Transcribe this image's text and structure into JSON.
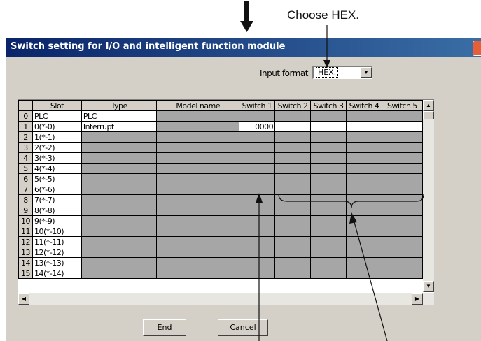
{
  "annotation": {
    "choose_text": "Choose HEX."
  },
  "dialog": {
    "title": "Switch setting for I/O and intelligent function module",
    "input_format_label": "Input format",
    "input_format_value": "HEX.",
    "buttons": {
      "end": "End",
      "cancel": "Cancel"
    }
  },
  "table": {
    "columns": [
      "",
      "Slot",
      "Type",
      "Model name",
      "Switch 1",
      "Switch 2",
      "Switch 3",
      "Switch 4",
      "Switch 5"
    ],
    "rows": [
      {
        "no": "0",
        "slot": "PLC",
        "type": "PLC",
        "model": "",
        "sw1": ""
      },
      {
        "no": "1",
        "slot": "0(*-0)",
        "type": "Interrupt",
        "model": "",
        "sw1": "0000"
      },
      {
        "no": "2",
        "slot": "1(*-1)",
        "type": "",
        "model": "",
        "sw1": ""
      },
      {
        "no": "3",
        "slot": "2(*-2)",
        "type": "",
        "model": "",
        "sw1": ""
      },
      {
        "no": "4",
        "slot": "3(*-3)",
        "type": "",
        "model": "",
        "sw1": ""
      },
      {
        "no": "5",
        "slot": "4(*-4)",
        "type": "",
        "model": "",
        "sw1": ""
      },
      {
        "no": "6",
        "slot": "5(*-5)",
        "type": "",
        "model": "",
        "sw1": ""
      },
      {
        "no": "7",
        "slot": "6(*-6)",
        "type": "",
        "model": "",
        "sw1": ""
      },
      {
        "no": "8",
        "slot": "7(*-7)",
        "type": "",
        "model": "",
        "sw1": ""
      },
      {
        "no": "9",
        "slot": "8(*-8)",
        "type": "",
        "model": "",
        "sw1": ""
      },
      {
        "no": "10",
        "slot": "9(*-9)",
        "type": "",
        "model": "",
        "sw1": ""
      },
      {
        "no": "11",
        "slot": "10(*-10)",
        "type": "",
        "model": "",
        "sw1": ""
      },
      {
        "no": "12",
        "slot": "11(*-11)",
        "type": "",
        "model": "",
        "sw1": ""
      },
      {
        "no": "13",
        "slot": "12(*-12)",
        "type": "",
        "model": "",
        "sw1": ""
      },
      {
        "no": "14",
        "slot": "13(*-13)",
        "type": "",
        "model": "",
        "sw1": ""
      },
      {
        "no": "15",
        "slot": "14(*-14)",
        "type": "",
        "model": "",
        "sw1": ""
      }
    ]
  },
  "icons": {
    "close": "close-icon",
    "dropdown": "dropdown-arrow-icon",
    "scroll_up": "scroll-up-icon",
    "scroll_down": "scroll-down-icon",
    "scroll_left": "scroll-left-icon",
    "scroll_right": "scroll-right-icon",
    "down_arrow": "down-arrow-icon"
  },
  "colors": {
    "title_start": "#0a246a",
    "title_end": "#3a6ea5",
    "window": "#d4d0c8",
    "cell_gray": "#a6a6a6"
  }
}
